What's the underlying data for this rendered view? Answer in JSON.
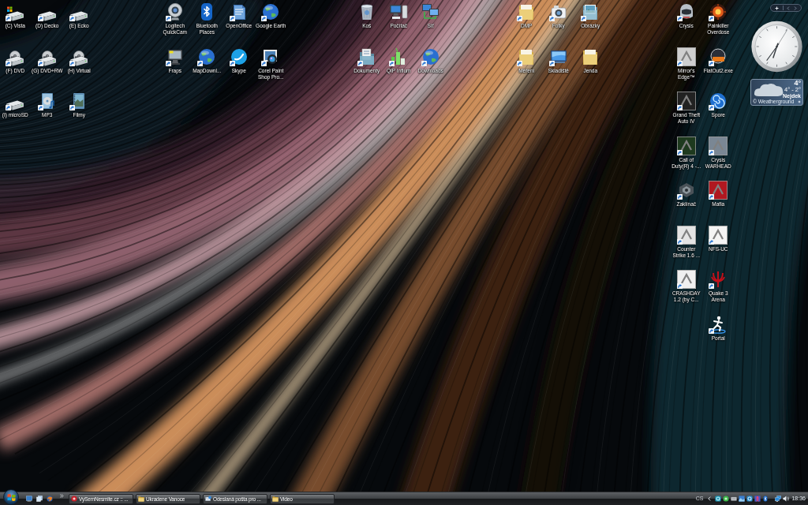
{
  "desktop": {
    "icon_groups": [
      {
        "columns": [
          {
            "icons": [
              {
                "label": "(C) Vista",
                "kind": "system-drive",
                "shortcut": true
              },
              {
                "label": "(F) DVD",
                "kind": "disc-drive",
                "shortcut": true
              },
              {
                "label": "(I) microSD",
                "kind": "drive",
                "shortcut": true
              }
            ]
          },
          {
            "icons": [
              {
                "label": "(D) Decko",
                "kind": "drive",
                "shortcut": true
              },
              {
                "label": "(G) DVD+RW",
                "kind": "disc-drive",
                "shortcut": true
              },
              {
                "label": "MP3",
                "kind": "music",
                "shortcut": true
              }
            ]
          },
          {
            "icons": [
              {
                "label": "(E) Ecko",
                "kind": "drive",
                "shortcut": true
              },
              {
                "label": "(H) Virtual",
                "kind": "disc-drive",
                "shortcut": true
              },
              {
                "label": "Filmy",
                "kind": "video",
                "shortcut": true
              }
            ]
          }
        ]
      },
      {
        "columns": [
          {
            "icons": [
              {
                "label": "Logitech QuickCam",
                "kind": "webcam",
                "shortcut": true
              },
              {
                "label": "Fraps",
                "kind": "monitor",
                "shortcut": true
              }
            ]
          },
          {
            "icons": [
              {
                "label": "Bluetooth Places",
                "kind": "bluetooth",
                "shortcut": false
              },
              {
                "label": "MapDownl...",
                "kind": "globe",
                "shortcut": true
              }
            ]
          },
          {
            "icons": [
              {
                "label": "OpenOffice",
                "kind": "document",
                "shortcut": true
              },
              {
                "label": "Skype",
                "kind": "chat",
                "shortcut": true
              }
            ]
          },
          {
            "icons": [
              {
                "label": "Google Earth",
                "kind": "globe",
                "shortcut": true
              },
              {
                "label": "Corel Paint Shop Pro...",
                "kind": "photo",
                "shortcut": true
              }
            ]
          }
        ]
      },
      {
        "columns": [
          {
            "icons": [
              {
                "label": "Koš",
                "kind": "bin",
                "shortcut": false
              },
              {
                "label": "Dokumenty",
                "kind": "documents",
                "shortcut": true
              }
            ]
          },
          {
            "icons": [
              {
                "label": "Počítač",
                "kind": "computer",
                "shortcut": false
              },
              {
                "label": "QIP Infium",
                "kind": "bars",
                "shortcut": true
              }
            ]
          },
          {
            "icons": [
              {
                "label": "Síť",
                "kind": "network",
                "shortcut": false
              },
              {
                "label": "Downloads",
                "kind": "globe",
                "shortcut": true
              }
            ]
          }
        ]
      },
      {
        "columns": [
          {
            "icons": [
              {
                "label": "DMP",
                "kind": "folder",
                "shortcut": true
              },
              {
                "label": "Měření",
                "kind": "folder",
                "shortcut": true
              }
            ]
          },
          {
            "icons": [
              {
                "label": "Fotky",
                "kind": "camera",
                "shortcut": true
              },
              {
                "label": "Skladiště",
                "kind": "screen",
                "shortcut": true
              }
            ]
          },
          {
            "icons": [
              {
                "label": "Obrázky",
                "kind": "pictures",
                "shortcut": true
              },
              {
                "label": "Jenda",
                "kind": "folder",
                "shortcut": false
              }
            ]
          }
        ]
      },
      {
        "columns": [
          {
            "icons": [
              {
                "label": "Crysis",
                "kind": "helmet",
                "shortcut": true
              },
              {
                "label": "Mirror's Edge™",
                "kind": "tile",
                "color": "#cfcfcf",
                "shortcut": true
              },
              {
                "label": "Grand Theft Auto IV",
                "kind": "tile",
                "color": "#222222",
                "shortcut": true
              },
              {
                "label": "Call of Duty(R) 4 -...",
                "kind": "tile",
                "color": "#1e3a1e",
                "shortcut": true
              },
              {
                "label": "Zaklínač",
                "kind": "emblem",
                "shortcut": true
              },
              {
                "label": "Counter Strike 1.6 ...",
                "kind": "tile",
                "color": "#e4e4e4",
                "shortcut": true
              },
              {
                "label": "CRASHDAY 1.2 (by C...",
                "kind": "tile",
                "color": "#f0f0f0",
                "shortcut": true
              }
            ]
          },
          {
            "icons": [
              {
                "label": "Painkiller Overdose",
                "kind": "flame",
                "shortcut": true
              },
              {
                "label": "FlatOut2.exe",
                "kind": "badge",
                "shortcut": true
              },
              {
                "label": "Spore",
                "kind": "swirl",
                "shortcut": true
              },
              {
                "label": "Crysis WARHEAD",
                "kind": "tile",
                "color": "#7a8794",
                "shortcut": true
              },
              {
                "label": "Mafia",
                "kind": "tile",
                "color": "#b01820",
                "shortcut": true
              },
              {
                "label": "NFS-UC",
                "kind": "tile",
                "color": "#f4f4f4",
                "shortcut": true
              },
              {
                "label": "Quake 3 Arena",
                "kind": "rune",
                "shortcut": true
              },
              {
                "label": "Portal",
                "kind": "figure",
                "shortcut": true
              }
            ]
          }
        ]
      }
    ]
  },
  "gadgets": {
    "weather": {
      "temperature": "4°",
      "range": "4° - 2°",
      "city": "Nejdek",
      "credit": "© Weatherground"
    }
  },
  "taskbar": {
    "windows": [
      {
        "label": "VySemNesmite.cz :: ...",
        "kind": "web",
        "selected": false
      },
      {
        "label": "Ukradene Vanoce",
        "kind": "folder",
        "selected": false
      },
      {
        "label": "Odeslaná pošta pro ...",
        "kind": "mail",
        "selected": false
      },
      {
        "label": "Video",
        "kind": "folder",
        "selected": false
      }
    ],
    "tray": {
      "language": "CS",
      "time": "18:36"
    }
  }
}
